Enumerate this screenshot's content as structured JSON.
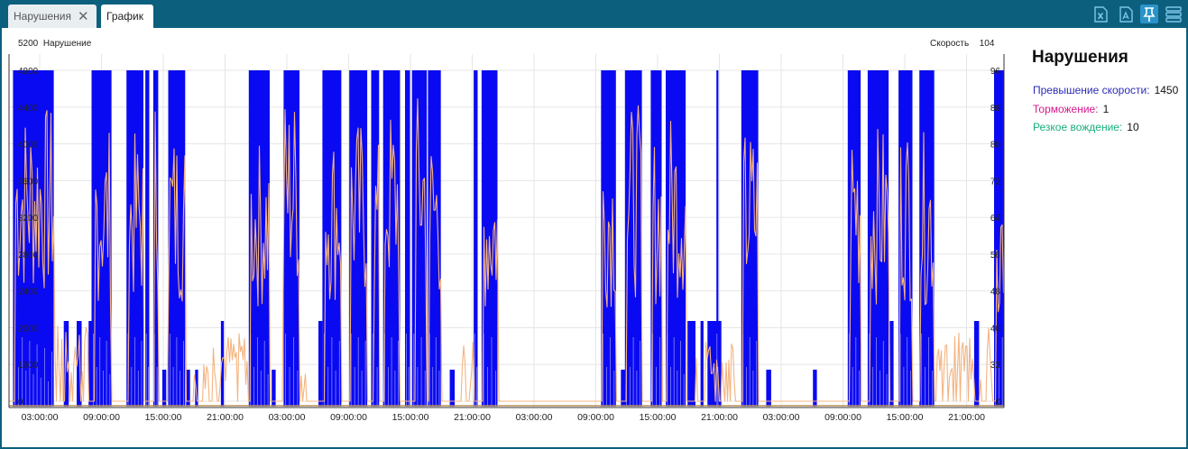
{
  "tabs": [
    {
      "label": "Нарушения",
      "closable": true
    },
    {
      "label": "График",
      "active": true
    }
  ],
  "toolbar": {
    "icons": [
      "excel-export-icon",
      "pdf-export-icon",
      "pin-icon",
      "layout-icon"
    ]
  },
  "chart": {
    "left_axis_max": "5200",
    "left_axis_label": "Нарушение",
    "right_axis_label": "Скорость",
    "right_axis_max": "104"
  },
  "legend": {
    "title": "Нарушения",
    "items": [
      {
        "label": "Превышение скорости:",
        "value": "1450",
        "color": "#2b2bb8"
      },
      {
        "label": "Торможение:",
        "value": "1",
        "color": "#d6178a"
      },
      {
        "label": "Резкое вождение:",
        "value": "10",
        "color": "#17b078"
      }
    ]
  },
  "chart_data": {
    "type": "area",
    "x_tick_labels": [
      "03:00:00",
      "09:00:00",
      "15:00:00",
      "21:00:00",
      "03:00:00",
      "09:00:00",
      "15:00:00",
      "21:00:00",
      "03:00:00",
      "09:00:00",
      "15:00:00",
      "21:00:00",
      "03:00:00",
      "09:00:00",
      "15:00:00",
      "21:00:00"
    ],
    "y_left_ticks": [
      "0",
      "1600",
      "2000",
      "2400",
      "2800",
      "3200",
      "3600",
      "4000",
      "4400",
      "4800"
    ],
    "y_right_ticks": [
      "0",
      "32",
      "40",
      "48",
      "56",
      "64",
      "72",
      "80",
      "88",
      "96"
    ],
    "colors": {
      "violations": "#0a0af2",
      "speed": "#f4b480"
    },
    "violation_blocks": [
      [
        0.004,
        0.045,
        4800
      ],
      [
        0.055,
        0.06,
        1900
      ],
      [
        0.068,
        0.073,
        1900
      ],
      [
        0.08,
        0.085,
        1900
      ],
      [
        0.083,
        0.103,
        4800
      ],
      [
        0.118,
        0.135,
        4800
      ],
      [
        0.137,
        0.141,
        4800
      ],
      [
        0.145,
        0.15,
        4800
      ],
      [
        0.154,
        0.158,
        1500
      ],
      [
        0.16,
        0.177,
        4800
      ],
      [
        0.178,
        0.182,
        1500
      ],
      [
        0.187,
        0.19,
        1500
      ],
      [
        0.213,
        0.216,
        1900
      ],
      [
        0.241,
        0.262,
        4800
      ],
      [
        0.264,
        0.268,
        1500
      ],
      [
        0.276,
        0.292,
        4800
      ],
      [
        0.311,
        0.315,
        1900
      ],
      [
        0.315,
        0.334,
        4800
      ],
      [
        0.342,
        0.36,
        4800
      ],
      [
        0.364,
        0.372,
        4800
      ],
      [
        0.376,
        0.393,
        4800
      ],
      [
        0.398,
        0.403,
        4800
      ],
      [
        0.405,
        0.42,
        4800
      ],
      [
        0.421,
        0.434,
        4800
      ],
      [
        0.443,
        0.448,
        1500
      ],
      [
        0.467,
        0.471,
        4800
      ],
      [
        0.475,
        0.491,
        4800
      ],
      [
        0.595,
        0.61,
        4800
      ],
      [
        0.615,
        0.62,
        1500
      ],
      [
        0.619,
        0.636,
        4800
      ],
      [
        0.645,
        0.656,
        4800
      ],
      [
        0.66,
        0.68,
        4800
      ],
      [
        0.682,
        0.69,
        1900
      ],
      [
        0.695,
        0.698,
        1900
      ],
      [
        0.702,
        0.716,
        1900
      ],
      [
        0.711,
        0.713,
        4800
      ],
      [
        0.736,
        0.753,
        4800
      ],
      [
        0.761,
        0.766,
        1500
      ],
      [
        0.808,
        0.812,
        1500
      ],
      [
        0.843,
        0.856,
        4800
      ],
      [
        0.863,
        0.884,
        4800
      ],
      [
        0.885,
        0.889,
        1900
      ],
      [
        0.894,
        0.908,
        4800
      ],
      [
        0.915,
        0.93,
        4800
      ],
      [
        0.97,
        0.975,
        1900
      ],
      [
        0.99,
        1.0,
        4800
      ]
    ],
    "speed_bursts": [
      [
        0.006,
        0.045,
        86
      ],
      [
        0.086,
        0.103,
        80
      ],
      [
        0.12,
        0.135,
        78
      ],
      [
        0.146,
        0.15,
        90
      ],
      [
        0.16,
        0.177,
        80
      ],
      [
        0.243,
        0.262,
        76
      ],
      [
        0.276,
        0.292,
        90
      ],
      [
        0.317,
        0.334,
        80
      ],
      [
        0.344,
        0.36,
        82
      ],
      [
        0.366,
        0.372,
        76
      ],
      [
        0.378,
        0.393,
        86
      ],
      [
        0.408,
        0.42,
        90
      ],
      [
        0.422,
        0.434,
        80
      ],
      [
        0.476,
        0.491,
        72
      ],
      [
        0.597,
        0.61,
        78
      ],
      [
        0.621,
        0.636,
        86
      ],
      [
        0.647,
        0.656,
        78
      ],
      [
        0.662,
        0.68,
        84
      ],
      [
        0.738,
        0.753,
        80
      ],
      [
        0.845,
        0.856,
        84
      ],
      [
        0.865,
        0.884,
        80
      ],
      [
        0.895,
        0.908,
        82
      ],
      [
        0.916,
        0.93,
        78
      ],
      [
        0.992,
        1.0,
        66
      ]
    ],
    "speed_low_segments": [
      [
        0.045,
        0.08,
        22
      ],
      [
        0.183,
        0.2,
        18
      ],
      [
        0.205,
        0.242,
        20
      ],
      [
        0.292,
        0.3,
        14
      ],
      [
        0.69,
        0.73,
        20
      ],
      [
        0.93,
        0.965,
        20
      ],
      [
        0.965,
        0.99,
        22
      ],
      [
        0.455,
        0.467,
        20
      ]
    ]
  }
}
